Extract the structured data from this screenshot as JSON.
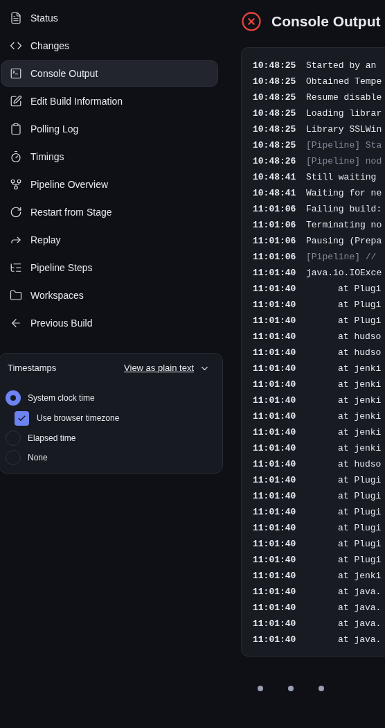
{
  "sidebar": {
    "items": [
      {
        "label": "Status",
        "selected": false
      },
      {
        "label": "Changes",
        "selected": false
      },
      {
        "label": "Console Output",
        "selected": true
      },
      {
        "label": "Edit Build Information",
        "selected": false
      },
      {
        "label": "Polling Log",
        "selected": false
      },
      {
        "label": "Timings",
        "selected": false
      },
      {
        "label": "Pipeline Overview",
        "selected": false
      },
      {
        "label": "Restart from Stage",
        "selected": false
      },
      {
        "label": "Replay",
        "selected": false
      },
      {
        "label": "Pipeline Steps",
        "selected": false
      },
      {
        "label": "Workspaces",
        "selected": false
      },
      {
        "label": "Previous Build",
        "selected": false
      }
    ]
  },
  "timestamps": {
    "title": "Timestamps",
    "link": "View as plain text",
    "options": [
      {
        "kind": "radio",
        "label": "System clock time",
        "selected": true
      },
      {
        "kind": "checkbox",
        "label": "Use browser timezone",
        "checked": true
      },
      {
        "kind": "radio",
        "label": "Elapsed time",
        "selected": false
      },
      {
        "kind": "radio",
        "label": "None",
        "selected": false
      }
    ]
  },
  "page": {
    "title": "Console Output"
  },
  "console": {
    "lines": [
      {
        "kind": "message",
        "time": "10:48:25",
        "text": "Started by an",
        "dim": false
      },
      {
        "kind": "message",
        "time": "10:48:25",
        "text": "Obtained Tempe",
        "dim": false
      },
      {
        "kind": "message",
        "time": "10:48:25",
        "text": "Resume disable",
        "dim": false
      },
      {
        "kind": "message",
        "time": "10:48:25",
        "text": "Loading librar",
        "dim": false
      },
      {
        "kind": "message",
        "time": "10:48:25",
        "text": "Library SSLWin",
        "dim": false
      },
      {
        "kind": "message",
        "time": "10:48:25",
        "text": "[Pipeline] Sta",
        "dim": true
      },
      {
        "kind": "message",
        "time": "10:48:26",
        "text": "[Pipeline] nod",
        "dim": true
      },
      {
        "kind": "message",
        "time": "10:48:41",
        "text": "Still waiting",
        "dim": false
      },
      {
        "kind": "message",
        "time": "10:48:41",
        "text": "Waiting for ne",
        "dim": false
      },
      {
        "kind": "message",
        "time": "11:01:06",
        "text": "Failing build:",
        "dim": false
      },
      {
        "kind": "message",
        "time": "11:01:06",
        "text": "Terminating no",
        "dim": false
      },
      {
        "kind": "message",
        "time": "11:01:06",
        "text": "Pausing (Prepa",
        "dim": false
      },
      {
        "kind": "message",
        "time": "11:01:06",
        "text": "[Pipeline] //",
        "dim": true
      },
      {
        "kind": "message",
        "time": "11:01:40",
        "text": "java.io.IOExce",
        "dim": false
      },
      {
        "kind": "frame",
        "time": "11:01:40",
        "text": "at Plugi",
        "dim": false
      },
      {
        "kind": "frame",
        "time": "11:01:40",
        "text": "at Plugi",
        "dim": false
      },
      {
        "kind": "frame",
        "time": "11:01:40",
        "text": "at Plugi",
        "dim": false
      },
      {
        "kind": "frame",
        "time": "11:01:40",
        "text": "at hudso",
        "dim": false
      },
      {
        "kind": "frame",
        "time": "11:01:40",
        "text": "at hudso",
        "dim": false
      },
      {
        "kind": "frame",
        "time": "11:01:40",
        "text": "at jenki",
        "dim": false
      },
      {
        "kind": "frame",
        "time": "11:01:40",
        "text": "at jenki",
        "dim": false
      },
      {
        "kind": "frame",
        "time": "11:01:40",
        "text": "at jenki",
        "dim": false
      },
      {
        "kind": "frame",
        "time": "11:01:40",
        "text": "at jenki",
        "dim": false
      },
      {
        "kind": "frame",
        "time": "11:01:40",
        "text": "at jenki",
        "dim": false
      },
      {
        "kind": "frame",
        "time": "11:01:40",
        "text": "at jenki",
        "dim": false
      },
      {
        "kind": "frame",
        "time": "11:01:40",
        "text": "at hudso",
        "dim": false
      },
      {
        "kind": "frame",
        "time": "11:01:40",
        "text": "at Plugi",
        "dim": false
      },
      {
        "kind": "frame",
        "time": "11:01:40",
        "text": "at Plugi",
        "dim": false
      },
      {
        "kind": "frame",
        "time": "11:01:40",
        "text": "at Plugi",
        "dim": false
      },
      {
        "kind": "frame",
        "time": "11:01:40",
        "text": "at Plugi",
        "dim": false
      },
      {
        "kind": "frame",
        "time": "11:01:40",
        "text": "at Plugi",
        "dim": false
      },
      {
        "kind": "frame",
        "time": "11:01:40",
        "text": "at Plugi",
        "dim": false
      },
      {
        "kind": "frame",
        "time": "11:01:40",
        "text": "at jenki",
        "dim": false
      },
      {
        "kind": "frame",
        "time": "11:01:40",
        "text": "at java.",
        "dim": false
      },
      {
        "kind": "frame",
        "time": "11:01:40",
        "text": "at java.",
        "dim": false
      },
      {
        "kind": "frame",
        "time": "11:01:40",
        "text": "at java.",
        "dim": false
      },
      {
        "kind": "frame",
        "time": "11:01:40",
        "text": "at java.",
        "dim": false
      }
    ]
  }
}
